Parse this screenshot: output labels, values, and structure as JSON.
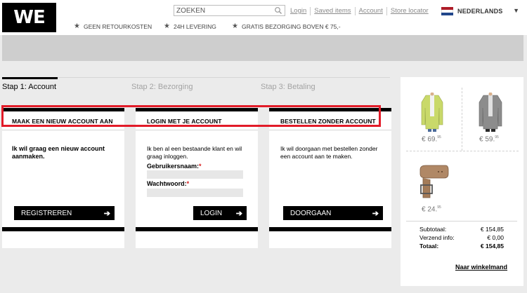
{
  "header": {
    "logo_text": "WE",
    "search": {
      "placeholder": "ZOEKEN"
    },
    "links": [
      "Login",
      "Saved items",
      "Account",
      "Store locator"
    ],
    "language": {
      "label": "NEDERLANDS",
      "flag_colors": [
        "#ae1c28",
        "#ffffff",
        "#21468b"
      ]
    },
    "usps": [
      "GEEN RETOURKOSTEN",
      "24H LEVERING",
      "GRATIS BEZORGING BOVEN € 75,-"
    ]
  },
  "steps": [
    {
      "label": "Stap 1: Account",
      "active": true
    },
    {
      "label": "Stap 2: Bezorging",
      "active": false
    },
    {
      "label": "Stap 3: Betaling",
      "active": false
    }
  ],
  "cards": {
    "new_account": {
      "title": "MAAK EEN NIEUW ACCOUNT AAN",
      "text": "Ik wil graag een nieuw account aanmaken.",
      "button": "REGISTREREN"
    },
    "login": {
      "title": "LOGIN MET JE ACCOUNT",
      "text": "Ik ben al een bestaande klant en wil graag inloggen.",
      "username_label": "Gebruikersnaam:",
      "password_label": "Wachtwoord:",
      "required_mark": "*",
      "button": "LOGIN"
    },
    "guest": {
      "title": "BESTELLEN ZONDER ACCOUNT",
      "text": "Ik wil doorgaan met bestellen zonder een account aan te maken.",
      "button": "DOORGAAN"
    }
  },
  "cart": {
    "items": [
      {
        "name": "yellow jacket",
        "price_main": "€ 69.",
        "price_cents": "95"
      },
      {
        "name": "grey jacket",
        "price_main": "€ 59.",
        "price_cents": "95"
      },
      {
        "name": "brown belt",
        "price_main": "€ 24.",
        "price_cents": "95"
      }
    ],
    "totals": [
      {
        "label": "Subtotaal:",
        "value": "€ 154,85"
      },
      {
        "label": "Verzend info:",
        "value": "€ 0,00"
      },
      {
        "label": "Totaal:",
        "value": "€ 154,85"
      }
    ],
    "link": "Naar winkelmand"
  },
  "colors": {
    "highlight": "#e21b28",
    "accent": "#000000",
    "required": "#d71a1a"
  }
}
